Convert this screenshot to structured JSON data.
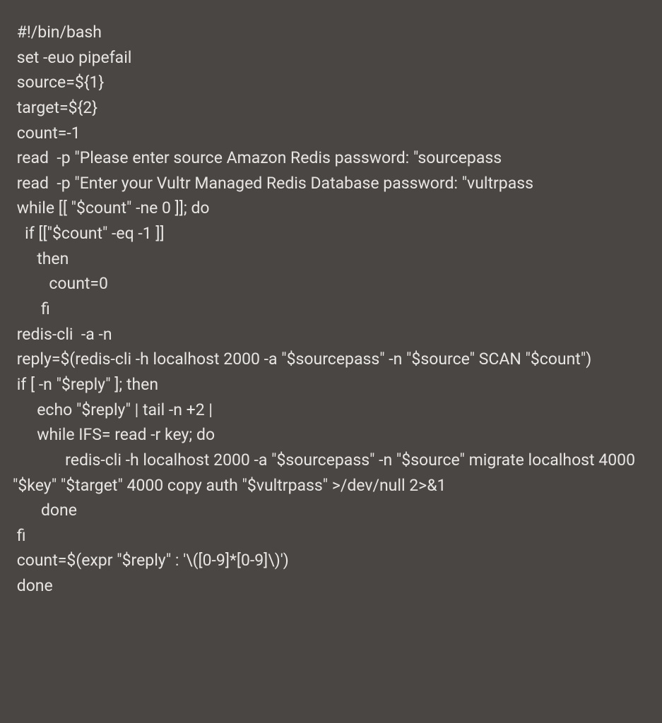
{
  "code": {
    "lines": [
      " #!/bin/bash",
      " set -euo pipefail",
      " source=${1}",
      " target=${2}",
      " count=-1",
      " read  -p \"Please enter source Amazon Redis password: \"sourcepass",
      " read  -p \"Enter your Vultr Managed Redis Database password: \"vultrpass",
      " while [[ \"$count\" -ne 0 ]]; do",
      "   if [[\"$count\" -eq -1 ]]",
      "      then",
      "         count=0",
      "       fi",
      " redis-cli  -a -n",
      " reply=$(redis-cli -h localhost 2000 -a \"$sourcepass\" -n \"$source\" SCAN \"$count\")",
      " if [ -n \"$reply\" ]; then",
      "      echo \"$reply\" | tail -n +2 |",
      "      while IFS= read -r key; do",
      "             redis-cli -h localhost 2000 -a \"$sourcepass\" -n \"$source\" migrate localhost 4000 \"$key\" \"$target\" 4000 copy auth \"$vultrpass\" >/dev/null 2>&1",
      "       done",
      " fi",
      " count=$(expr \"$reply\" : '\\([0-9]*[0-9]\\)')",
      " done"
    ]
  }
}
